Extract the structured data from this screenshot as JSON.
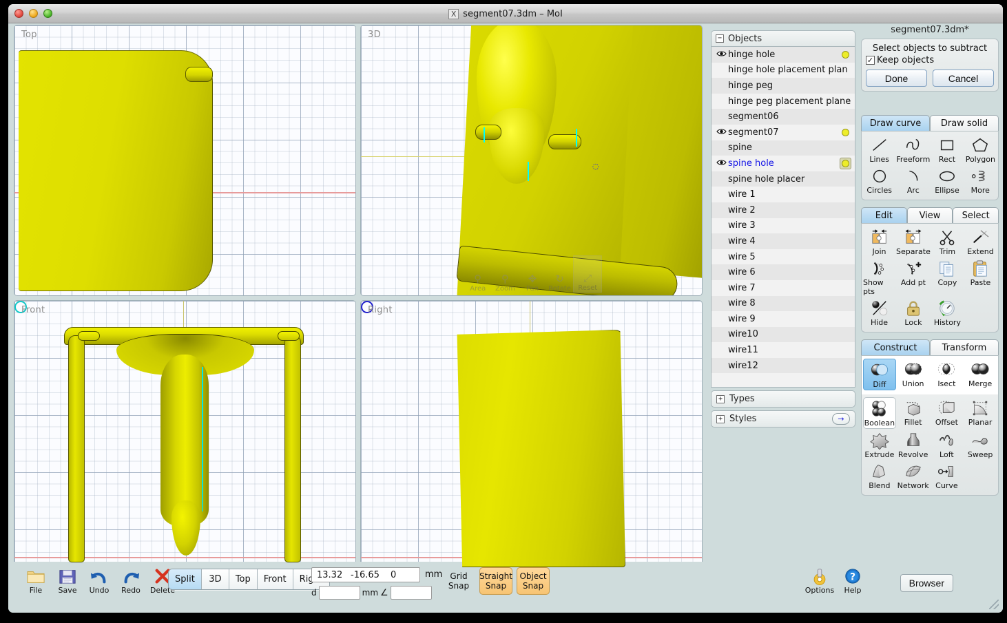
{
  "window": {
    "title": "segment07.3dm – MoI",
    "title_icon": "X",
    "traffic_lights": [
      "close-button",
      "minimize-button",
      "zoom-button"
    ]
  },
  "viewports": [
    {
      "name": "top",
      "label": "Top"
    },
    {
      "name": "3d",
      "label": "3D"
    },
    {
      "name": "front",
      "label": "Front"
    },
    {
      "name": "right",
      "label": "Right"
    }
  ],
  "nav_controls": [
    {
      "label": "Area",
      "glyph": "⌕"
    },
    {
      "label": "Zoom",
      "glyph": "⌕"
    },
    {
      "label": "Pan",
      "glyph": "✣"
    },
    {
      "label": "Rotate",
      "glyph": "↻"
    },
    {
      "label": "Reset",
      "glyph": "⤢"
    }
  ],
  "objects_panel": {
    "header": "Objects",
    "collapse_glyph": "−",
    "items": [
      {
        "name": "hinge hole",
        "visible": true,
        "swatch": "dot",
        "selected": false
      },
      {
        "name": "hinge hole placement plan",
        "visible": false,
        "swatch": "none",
        "selected": false
      },
      {
        "name": "hinge peg",
        "visible": false,
        "swatch": "none",
        "selected": false
      },
      {
        "name": "hinge peg placement plane",
        "visible": false,
        "swatch": "none",
        "selected": false
      },
      {
        "name": "segment06",
        "visible": false,
        "swatch": "none",
        "selected": false
      },
      {
        "name": "segment07",
        "visible": true,
        "swatch": "dot",
        "selected": false
      },
      {
        "name": "spine",
        "visible": false,
        "swatch": "none",
        "selected": false
      },
      {
        "name": "spine hole",
        "visible": true,
        "swatch": "framed",
        "selected": true
      },
      {
        "name": "spine hole placer",
        "visible": false,
        "swatch": "none",
        "selected": false
      },
      {
        "name": "wire 1",
        "visible": false,
        "swatch": "none",
        "selected": false
      },
      {
        "name": "wire 2",
        "visible": false,
        "swatch": "none",
        "selected": false
      },
      {
        "name": "wire 3",
        "visible": false,
        "swatch": "none",
        "selected": false
      },
      {
        "name": "wire 4",
        "visible": false,
        "swatch": "none",
        "selected": false
      },
      {
        "name": "wire 5",
        "visible": false,
        "swatch": "none",
        "selected": false
      },
      {
        "name": "wire 6",
        "visible": false,
        "swatch": "none",
        "selected": false
      },
      {
        "name": "wire 7",
        "visible": false,
        "swatch": "none",
        "selected": false
      },
      {
        "name": "wire 8",
        "visible": false,
        "swatch": "none",
        "selected": false
      },
      {
        "name": "wire 9",
        "visible": false,
        "swatch": "none",
        "selected": false
      },
      {
        "name": "wire10",
        "visible": false,
        "swatch": "none",
        "selected": false
      },
      {
        "name": "wire11",
        "visible": false,
        "swatch": "none",
        "selected": false
      },
      {
        "name": "wire12",
        "visible": false,
        "swatch": "none",
        "selected": false
      }
    ],
    "types": {
      "label": "Types",
      "expand_glyph": "+"
    },
    "styles": {
      "label": "Styles",
      "expand_glyph": "+",
      "arrow_glyph": "→"
    }
  },
  "command_panel": {
    "document_title": "segment07.3dm*",
    "prompt": "Select objects to subtract",
    "keep_objects_label": "Keep objects",
    "keep_objects_checked": true,
    "check_glyph": "✓",
    "done_label": "Done",
    "cancel_label": "Cancel",
    "draw_tabs": [
      {
        "label": "Draw curve",
        "active": true
      },
      {
        "label": "Draw solid",
        "active": false
      }
    ],
    "draw_tools": [
      {
        "label": "Lines",
        "icon": "line-icon"
      },
      {
        "label": "Freeform",
        "icon": "freeform-icon"
      },
      {
        "label": "Rect",
        "icon": "rect-icon"
      },
      {
        "label": "Polygon",
        "icon": "polygon-icon"
      },
      {
        "label": "Circles",
        "icon": "circle-icon"
      },
      {
        "label": "Arc",
        "icon": "arc-icon"
      },
      {
        "label": "Ellipse",
        "icon": "ellipse-icon"
      },
      {
        "label": "More",
        "icon": "more-curves-icon"
      }
    ],
    "edit_tabs": [
      {
        "label": "Edit",
        "active": true
      },
      {
        "label": "View",
        "active": false
      },
      {
        "label": "Select",
        "active": false
      }
    ],
    "edit_tools": [
      {
        "label": "Join",
        "icon": "join-icon"
      },
      {
        "label": "Separate",
        "icon": "separate-icon"
      },
      {
        "label": "Trim",
        "icon": "scissors-icon"
      },
      {
        "label": "Extend",
        "icon": "extend-icon"
      },
      {
        "label": "Show pts",
        "icon": "show-points-icon"
      },
      {
        "label": "Add pt",
        "icon": "add-point-icon"
      },
      {
        "label": "Copy",
        "icon": "copy-icon"
      },
      {
        "label": "Paste",
        "icon": "paste-icon"
      },
      {
        "label": "Hide",
        "icon": "hide-icon"
      },
      {
        "label": "Lock",
        "icon": "lock-icon"
      },
      {
        "label": "History",
        "icon": "history-icon"
      }
    ],
    "construct_tabs": [
      {
        "label": "Construct",
        "active": true
      },
      {
        "label": "Transform",
        "active": false
      }
    ],
    "boolean_tools": [
      {
        "label": "Diff",
        "icon": "boolean-diff-icon",
        "selected": true
      },
      {
        "label": "Union",
        "icon": "boolean-union-icon",
        "selected": false
      },
      {
        "label": "Isect",
        "icon": "boolean-isect-icon",
        "selected": false
      },
      {
        "label": "Merge",
        "icon": "boolean-merge-icon",
        "selected": false
      }
    ],
    "construct_tools": [
      {
        "label": "Boolean",
        "icon": "boolean-group-icon"
      },
      {
        "label": "Fillet",
        "icon": "fillet-icon"
      },
      {
        "label": "Offset",
        "icon": "offset-icon"
      },
      {
        "label": "Planar",
        "icon": "planar-icon"
      },
      {
        "label": "Extrude",
        "icon": "extrude-icon"
      },
      {
        "label": "Revolve",
        "icon": "revolve-icon"
      },
      {
        "label": "Loft",
        "icon": "loft-icon"
      },
      {
        "label": "Sweep",
        "icon": "sweep-icon"
      },
      {
        "label": "Blend",
        "icon": "blend-icon"
      },
      {
        "label": "Network",
        "icon": "network-icon"
      },
      {
        "label": "Curve",
        "icon": "curve-icon"
      }
    ]
  },
  "bottom_toolbar": {
    "file_tools": [
      {
        "label": "File",
        "icon": "folder-icon"
      },
      {
        "label": "Save",
        "icon": "floppy-disk-icon"
      },
      {
        "label": "Undo",
        "icon": "undo-arrow-icon"
      },
      {
        "label": "Redo",
        "icon": "redo-arrow-icon"
      },
      {
        "label": "Delete",
        "icon": "x-delete-icon"
      }
    ],
    "view_buttons": [
      {
        "label": "Split",
        "active": true
      },
      {
        "label": "3D",
        "active": false
      },
      {
        "label": "Top",
        "active": false
      },
      {
        "label": "Front",
        "active": false
      },
      {
        "label": "Right",
        "active": false
      }
    ],
    "coordinates": {
      "x": "13.32",
      "y": "-16.65",
      "z": "0",
      "unit": "mm",
      "distance_label": "d",
      "distance_value": "",
      "distance_unit": "mm",
      "angle_glyph": "∠",
      "angle_value": ""
    },
    "snaps": [
      {
        "label_line1": "Grid",
        "label_line2": "Snap",
        "on": false
      },
      {
        "label_line1": "Straight",
        "label_line2": "Snap",
        "on": true
      },
      {
        "label_line1": "Object",
        "label_line2": "Snap",
        "on": true
      }
    ],
    "right_tools": [
      {
        "label": "Options",
        "icon": "gear-icon"
      },
      {
        "label": "Help",
        "icon": "help-question-icon"
      }
    ],
    "browser_label": "Browser"
  }
}
